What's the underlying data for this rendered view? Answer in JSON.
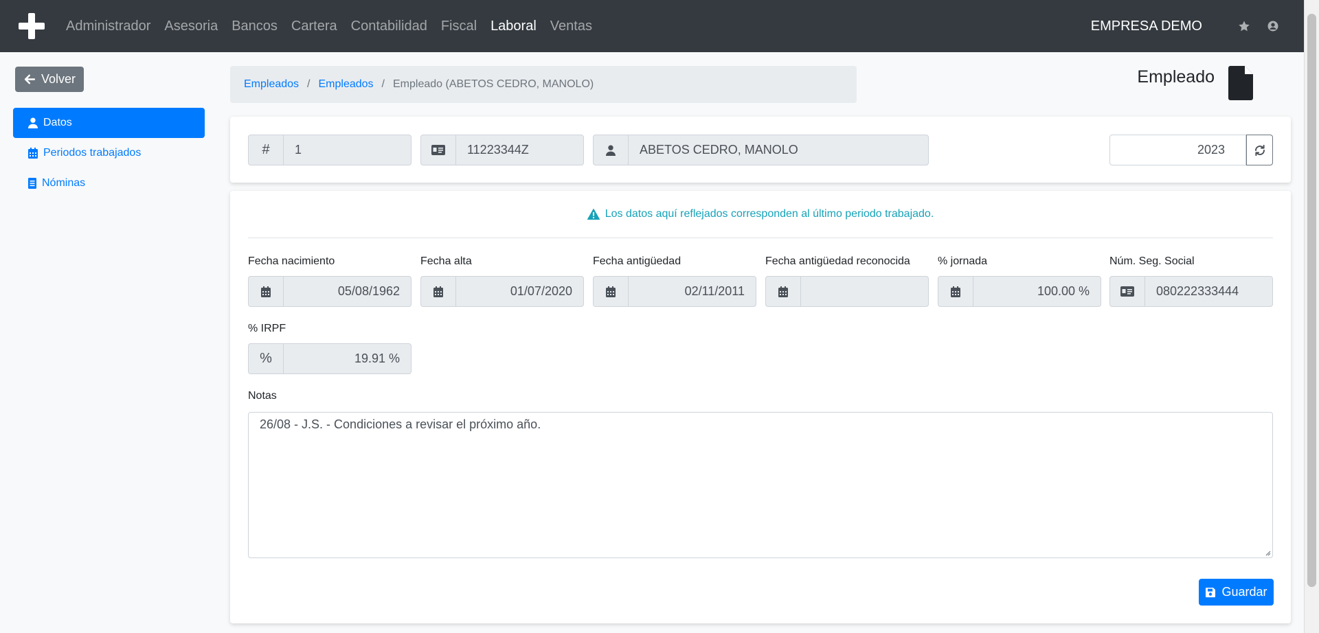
{
  "navbar": {
    "nav_items": [
      "Administrador",
      "Asesoria",
      "Bancos",
      "Cartera",
      "Contabilidad",
      "Fiscal",
      "Laboral",
      "Ventas"
    ],
    "active_item": "Laboral",
    "company": "EMPRESA DEMO"
  },
  "sidebar": {
    "back_label": "Volver",
    "items": [
      {
        "label": "Datos",
        "icon": "user-icon",
        "active": true
      },
      {
        "label": "Periodos trabajados",
        "icon": "calendar-icon",
        "active": false
      },
      {
        "label": "Nóminas",
        "icon": "document-icon",
        "active": false
      }
    ]
  },
  "breadcrumb": {
    "items": [
      "Empleados",
      "Empleados"
    ],
    "current": "Empleado (ABETOS CEDRO, MANOLO)"
  },
  "page_title": "Empleado",
  "header_fields": {
    "id_addon": "#",
    "id": "1",
    "nif": "11223344Z",
    "name": "ABETOS CEDRO, MANOLO",
    "year": "2023"
  },
  "notice": "Los datos aquí reflejados corresponden al último periodo trabajado.",
  "fields": {
    "birth_date": {
      "label": "Fecha nacimiento",
      "value": "05/08/1962"
    },
    "hire_date": {
      "label": "Fecha alta",
      "value": "01/07/2020"
    },
    "seniority_date": {
      "label": "Fecha antigüedad",
      "value": "02/11/2011"
    },
    "recognized_seniority_date": {
      "label": "Fecha antigüedad reconocida",
      "value": ""
    },
    "workday_pct": {
      "label": "% jornada",
      "value": "100.00 %"
    },
    "social_security": {
      "label": "Núm. Seg. Social",
      "value": "080222333444"
    },
    "irpf": {
      "label": "% IRPF",
      "addon": "%",
      "value": "19.91 %"
    }
  },
  "notes": {
    "label": "Notas",
    "value": "26/08 - J.S. - Condiciones a revisar el próximo año."
  },
  "save_label": "Guardar",
  "colors": {
    "navbar_bg": "#343a40",
    "primary": "#007bff",
    "info": "#17a2b8",
    "secondary": "#6c757d"
  }
}
